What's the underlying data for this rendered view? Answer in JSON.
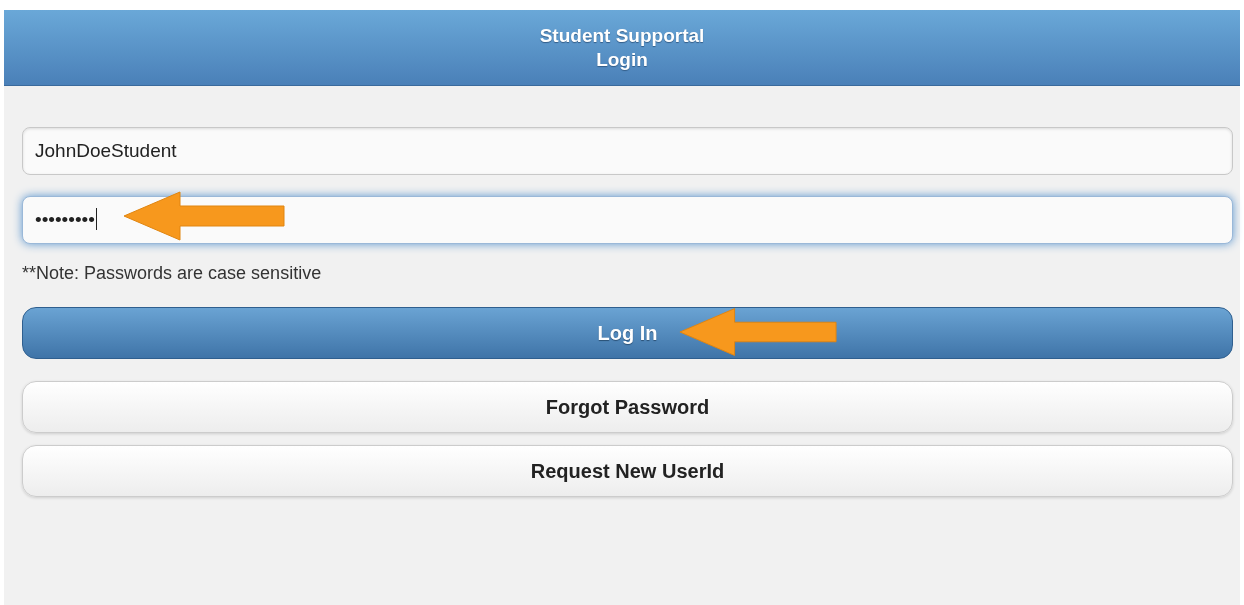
{
  "header": {
    "title": "Student Supportal",
    "subtitle": "Login"
  },
  "fields": [
    {
      "value": "JohnDoeStudent",
      "focused": false,
      "arrow": false
    },
    {
      "value": "•••••••••",
      "focused": true,
      "arrow": true
    }
  ],
  "note": "**Note: Passwords are case sensitive",
  "buttons": [
    {
      "label": "Log In",
      "kind": "primary",
      "arrow": true
    },
    {
      "label": "Forgot Password",
      "kind": "secondary",
      "arrow": false
    },
    {
      "label": "Request New UserId",
      "kind": "secondary",
      "arrow": false
    }
  ]
}
